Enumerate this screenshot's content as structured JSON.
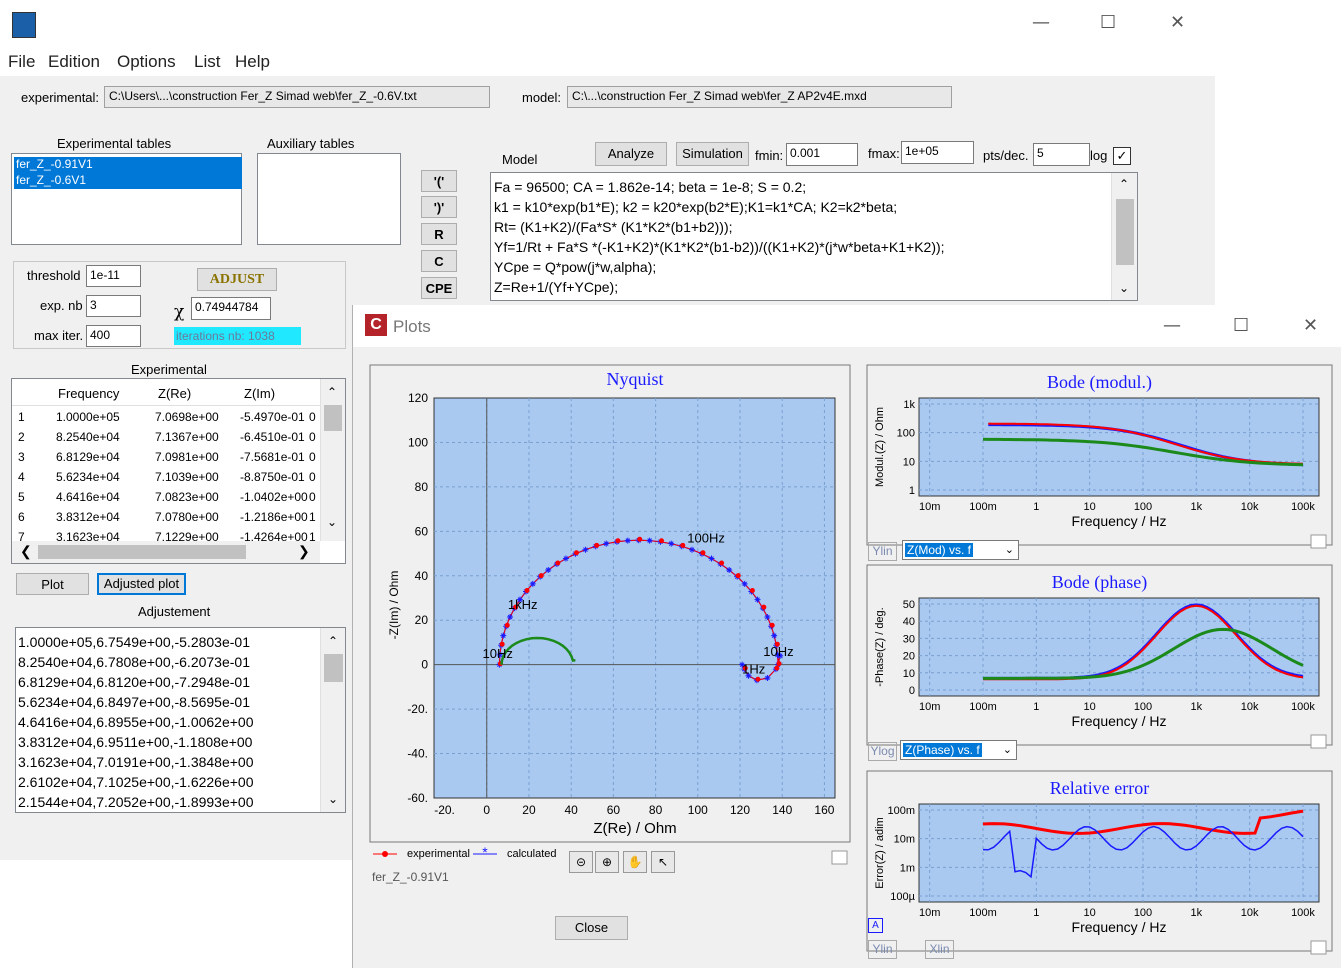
{
  "main": {
    "menu": [
      "File",
      "Edition",
      "Options",
      "List",
      "Help"
    ],
    "experimental_label": "experimental:",
    "experimental_path": "C:\\Users\\...\\construction Fer_Z Simad web\\fer_Z_-0.6V.txt",
    "model_label": "model:",
    "model_path": "C:\\...\\construction Fer_Z Simad web\\fer_Z AP2v4E.mxd",
    "exp_tables_title": "Experimental tables",
    "exp_tables": [
      "fer_Z_-0.91V1",
      "fer_Z_-0.6V1"
    ],
    "aux_tables_title": "Auxiliary tables",
    "model_title": "Model",
    "analyze_btn": "Analyze",
    "simulation_btn": "Simulation",
    "fmin_label": "fmin:",
    "fmin_value": "0.001",
    "fmax_label": "fmax:",
    "fmax_value": "1e+05",
    "pts_label": "pts/dec.",
    "pts_value": "5",
    "log_label": "log",
    "elem_buttons": [
      "'('",
      "')'",
      "R",
      "C",
      "CPE"
    ],
    "model_lines": [
      "Fa = 96500; CA = 1.862e-14; beta = 1e-8; S = 0.2;",
      "k1 = k10*exp(b1*E); k2 = k20*exp(b2*E);K1=k1*CA; K2=k2*beta;",
      "Rt= (K1+K2)/(Fa*S* (K1*K2*(b1+b2)));",
      "Yf=1/Rt + Fa*S *(-K1+K2)*(K1*K2*(b1-b2))/((K1+K2)*(j*w*beta+K1+K2));",
      "YCpe = Q*pow(j*w,alpha);",
      "Z=Re+1/(Yf+YCpe);"
    ],
    "threshold_label": "threshold",
    "threshold_value": "1e-11",
    "expnb_label": "exp. nb",
    "expnb_value": "3",
    "maxiter_label": "max iter.",
    "maxiter_value": "400",
    "adjust_btn": "ADJUST",
    "chi_symbol": "χ",
    "chi_value": "0.74944784",
    "iterations_text": "iterations nb: 1038",
    "experimental_title": "Experimental",
    "table_headers": [
      "Frequency",
      "Z(Re)",
      "Z(Im)"
    ],
    "table_rows": [
      {
        "n": "1",
        "f": "1.0000e+05",
        "re": "7.0698e+00",
        "im": "-5.4970e-01",
        "x": "0"
      },
      {
        "n": "2",
        "f": "8.2540e+04",
        "re": "7.1367e+00",
        "im": "-6.4510e-01",
        "x": "0"
      },
      {
        "n": "3",
        "f": "6.8129e+04",
        "re": "7.0981e+00",
        "im": "-7.5681e-01",
        "x": "0"
      },
      {
        "n": "4",
        "f": "5.6234e+04",
        "re": "7.1039e+00",
        "im": "-8.8750e-01",
        "x": "0"
      },
      {
        "n": "5",
        "f": "4.6416e+04",
        "re": "7.0823e+00",
        "im": "-1.0402e+00",
        "x": "0"
      },
      {
        "n": "6",
        "f": "3.8312e+04",
        "re": "7.0780e+00",
        "im": "-1.2186e+00",
        "x": "1"
      },
      {
        "n": "7",
        "f": "3.1623e+04",
        "re": "7.1229e+00",
        "im": "-1.4264e+00",
        "x": "1"
      }
    ],
    "plot_btn": "Plot",
    "adjusted_plot_btn": "Adjusted plot",
    "adjustement_title": "Adjustement",
    "adjustement_lines": [
      "1.0000e+05,6.7549e+00,-5.2803e-01",
      "8.2540e+04,6.7808e+00,-6.2073e-01",
      "6.8129e+04,6.8120e+00,-7.2948e-01",
      "5.6234e+04,6.8497e+00,-8.5695e-01",
      "4.6416e+04,6.8955e+00,-1.0062e+00",
      "3.8312e+04,6.9511e+00,-1.1808e+00",
      "3.1623e+04,7.0191e+00,-1.3848e+00",
      "2.6102e+04,7.1025e+00,-1.6226e+00",
      "2.1544e+04,7.2052e+00,-1.8993e+00"
    ]
  },
  "plots": {
    "title": "Plots",
    "nyquist_title": "Nyquist",
    "nyquist_xlabel": "Z(Re) / Ohm",
    "nyquist_ylabel": "-Z(Im) / Ohm",
    "nyquist_xticks": [
      "-20.",
      "0",
      "20",
      "40",
      "60",
      "80",
      "100",
      "120",
      "140",
      "160"
    ],
    "nyquist_yticks": [
      "120",
      "100",
      "80",
      "60",
      "40",
      "20",
      "0",
      "-20.",
      "-40.",
      "-60."
    ],
    "freq_annotations": [
      "100Hz",
      "1kHz",
      "10Hz",
      "10Hz",
      "1Hz"
    ],
    "legend_experimental": "experimental",
    "legend_calculated": "calculated",
    "file_label": "fer_Z_-0.91V1",
    "close_btn": "Close",
    "bode_mod_title": "Bode (modul.)",
    "bode_mod_ylabel": "Modul.(Z) / Ohm",
    "bode_mod_yticks": [
      "1k",
      "100",
      "10",
      "1"
    ],
    "bode_phase_title": "Bode (phase)",
    "bode_phase_ylabel": "-Phase(Z) / deg.",
    "bode_phase_yticks": [
      "50",
      "40",
      "30",
      "20",
      "10",
      "0"
    ],
    "rel_err_title": "Relative error",
    "rel_err_ylabel": "Error(Z) / adim",
    "rel_err_yticks": [
      "100m",
      "10m",
      "1m",
      "100µ"
    ],
    "freq_xticks": [
      "10m",
      "100m",
      "1",
      "10",
      "100",
      "1k",
      "10k",
      "100k"
    ],
    "freq_xlabel": "Frequency / Hz",
    "ylin_label": "Ylin",
    "ylog_label": "Ylog",
    "xlin_label": "Xlin",
    "mod_dropdown": "Z(Mod) vs. f",
    "phase_dropdown": "Z(Phase) vs. f",
    "a_label": "A"
  },
  "colors": {
    "experimental": "#ff0000",
    "calculated": "#1a1aff",
    "auxiliary": "#1b8a1b",
    "plot_bg": "#a9c9f1",
    "title": "#1a1aff"
  }
}
